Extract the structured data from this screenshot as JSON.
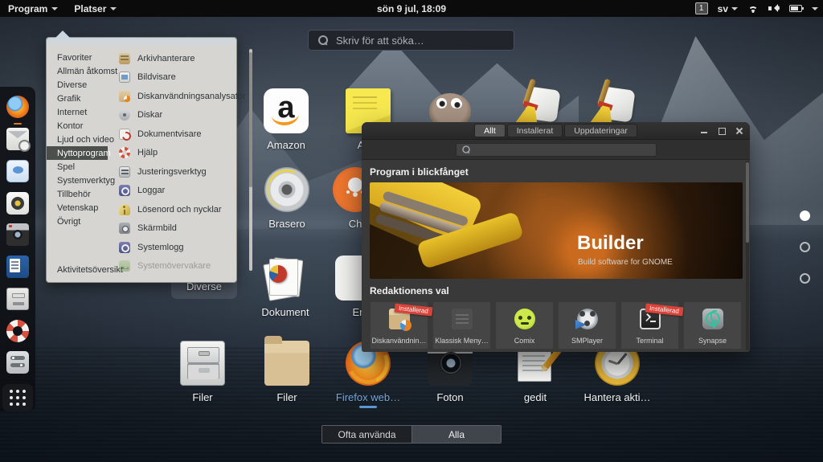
{
  "topbar": {
    "program_label": "Program",
    "platser_label": "Platser",
    "clock": "sön  9 jul, 18:09",
    "workspace_number": "1",
    "keyboard_layout": "sv",
    "status_icons": [
      "wifi-icon",
      "volume-icon",
      "battery-icon"
    ]
  },
  "overview": {
    "search_placeholder": "Skriv för att söka…",
    "page_dots": {
      "count": 3,
      "active_index": 0
    },
    "bottom_tabs": {
      "frequent": "Ofta använda",
      "all": "Alla",
      "selected": "Alla"
    }
  },
  "dock": {
    "items": [
      "firefox",
      "evolution",
      "chat",
      "music-player",
      "camera",
      "libreoffice-writer",
      "file-manager",
      "help",
      "tweaks"
    ],
    "apps_button": "show-applications"
  },
  "app_menu": {
    "categories": [
      "Favoriter",
      "Allmän åtkomst",
      "Diverse",
      "Grafik",
      "Internet",
      "Kontor",
      "Ljud och video",
      "Nyttoprogram",
      "Spel",
      "Systemverktyg",
      "Tillbehör",
      "Vetenskap",
      "Övrigt"
    ],
    "selected_category": "Nyttoprogram",
    "items": [
      {
        "label": "Arkivhanterare",
        "icon": "archive-manager-icon"
      },
      {
        "label": "Bildvisare",
        "icon": "image-viewer-icon"
      },
      {
        "label": "Diskanvändningsanalysator",
        "icon": "disk-usage-icon"
      },
      {
        "label": "Diskar",
        "icon": "disks-icon"
      },
      {
        "label": "Dokumentvisare",
        "icon": "document-viewer-icon"
      },
      {
        "label": "Hjälp",
        "icon": "help-icon"
      },
      {
        "label": "Justeringsverktyg",
        "icon": "tweaks-icon"
      },
      {
        "label": "Loggar",
        "icon": "logs-icon"
      },
      {
        "label": "Lösenord och nycklar",
        "icon": "keys-icon"
      },
      {
        "label": "Skärmbild",
        "icon": "screenshot-icon"
      },
      {
        "label": "Systemlogg",
        "icon": "system-log-icon"
      },
      {
        "label": "Systemövervakare",
        "icon": "system-monitor-icon",
        "disabled": true
      }
    ],
    "footer": "Aktivitetsöversikt"
  },
  "app_grid": {
    "icons": [
      {
        "label": "Amazon",
        "icon": "amazon",
        "logo_letter": "a"
      },
      {
        "label": "Ante",
        "icon": "sticky-notes"
      },
      {
        "icon": "gimp"
      },
      {
        "icon": "broom-cleaner"
      },
      {
        "icon": "broom-cleaner"
      },
      {
        "label": "Brasero",
        "icon": "disc-burner"
      },
      {
        "label": "Ch",
        "icon": "orange-app"
      },
      {
        "label": "Diverse",
        "icon": "folder-group-chart"
      },
      {
        "label": "Dokument",
        "icon": "documents"
      },
      {
        "label": "Er",
        "icon": "white-app"
      },
      {
        "label": "Filer",
        "icon": "file-cabinet"
      },
      {
        "label": "Filer",
        "icon": "folder"
      },
      {
        "label": "Firefox web…",
        "icon": "firefox",
        "running": true
      },
      {
        "label": "Foton",
        "icon": "camera"
      },
      {
        "label": "gedit",
        "icon": "text-editor"
      },
      {
        "label": "Hantera akti…",
        "icon": "clock"
      }
    ]
  },
  "software": {
    "tabs": [
      {
        "label": "Allt",
        "active": true
      },
      {
        "label": "Installerat",
        "active": false
      },
      {
        "label": "Uppdateringar",
        "active": false
      }
    ],
    "search_value": "",
    "featured_heading": "Program i blickfånget",
    "banner": {
      "title": "Builder",
      "subtitle": "Build software for GNOME"
    },
    "picks_heading": "Redaktionens val",
    "tiles": [
      {
        "label": "Diskanvändnin…",
        "icon": "disk-usage",
        "badge": "Installerad"
      },
      {
        "label": "Klassisk Meny…",
        "icon": "classic-menu"
      },
      {
        "label": "Comix",
        "icon": "comix"
      },
      {
        "label": "SMPlayer",
        "icon": "smplayer"
      },
      {
        "label": "Terminal",
        "icon": "terminal",
        "badge": "Installerad"
      },
      {
        "label": "Synapse",
        "icon": "synapse"
      }
    ]
  }
}
